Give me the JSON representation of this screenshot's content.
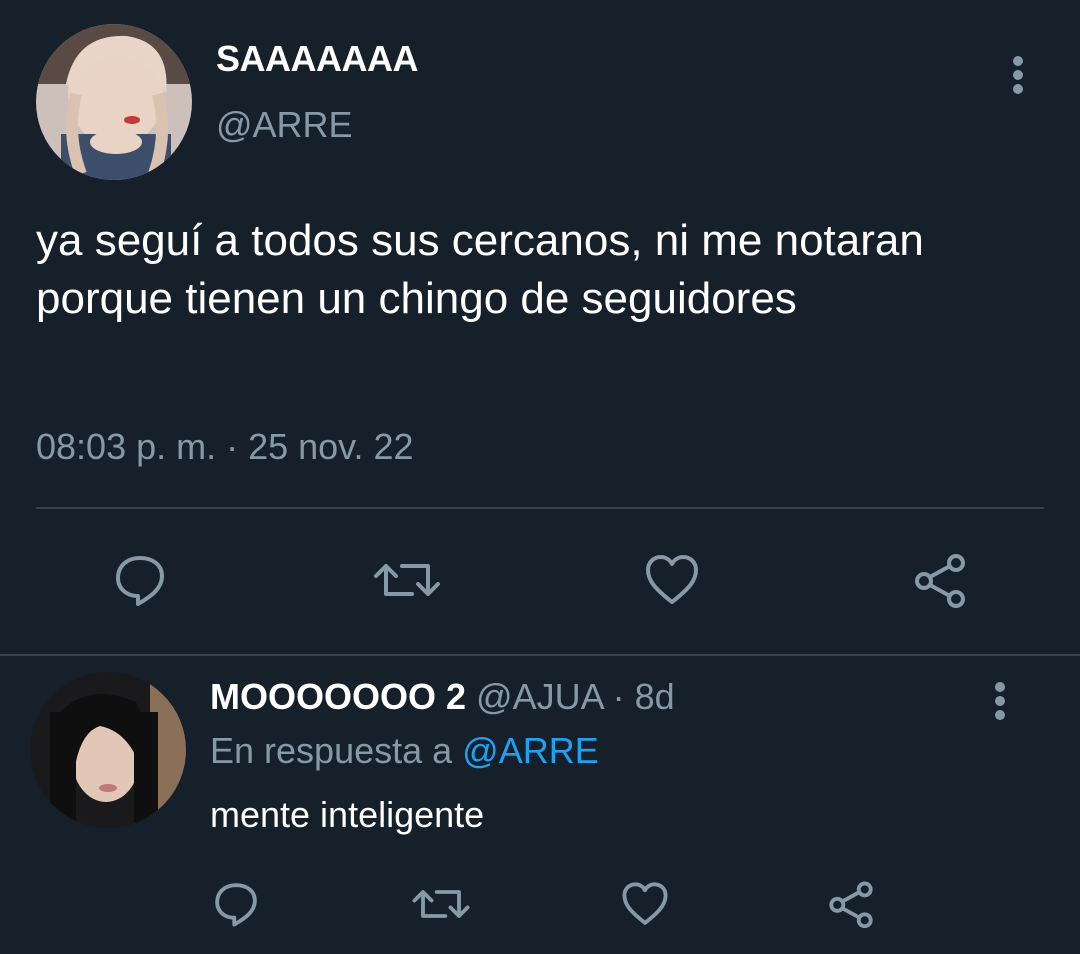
{
  "main_tweet": {
    "author_name": "SAAAAAAA",
    "author_handle": "@ARRE",
    "avatar_icon": "user-avatar-photo",
    "text": "ya seguí a todos sus cercanos, ni me notaran porque tienen un chingo de seguidores",
    "timestamp": "08:03 p. m. · 25 nov. 22",
    "actions": [
      "reply-icon",
      "retweet-icon",
      "like-icon",
      "share-icon"
    ]
  },
  "reply": {
    "author_name": "MOOOOOOO 2",
    "author_handle": "@AJUA",
    "time": "· 8d",
    "replying_prefix": "En respuesta a",
    "replying_to": "@ARRE",
    "text": "mente inteligente",
    "avatar_icon": "user-avatar-photo",
    "actions": [
      "reply-icon",
      "retweet-icon",
      "like-icon",
      "share-icon"
    ]
  },
  "colors": {
    "background": "#15202b",
    "text": "#ffffff",
    "muted": "#8899a6",
    "accent": "#1da1f2",
    "divider": "#38444d"
  }
}
